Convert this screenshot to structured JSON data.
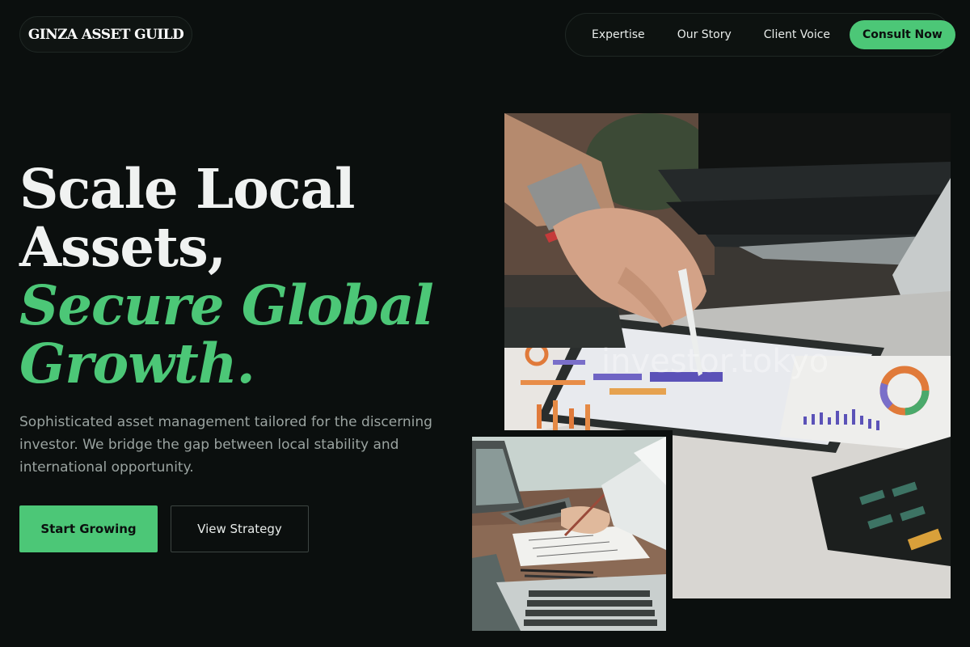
{
  "brand": {
    "logo_text": "GINZA ASSET GUILD"
  },
  "nav": {
    "links": [
      "Expertise",
      "Our Story",
      "Client Voice"
    ],
    "cta_label": "Consult Now"
  },
  "hero": {
    "title_line1": "Scale Local",
    "title_line2": "Assets,",
    "title_accent_line1": "Secure Global",
    "title_accent_line2": "Growth.",
    "description": "Sophisticated asset management tailored for the discerning investor. We bridge the gap between local stability and international opportunity.",
    "primary_button": "Start Growing",
    "secondary_button": "View Strategy"
  },
  "images": {
    "main_watermark": "investor.tokyo"
  },
  "colors": {
    "background": "#0b0f0e",
    "accent": "#4cc777",
    "muted_text": "#9aa3a0"
  }
}
